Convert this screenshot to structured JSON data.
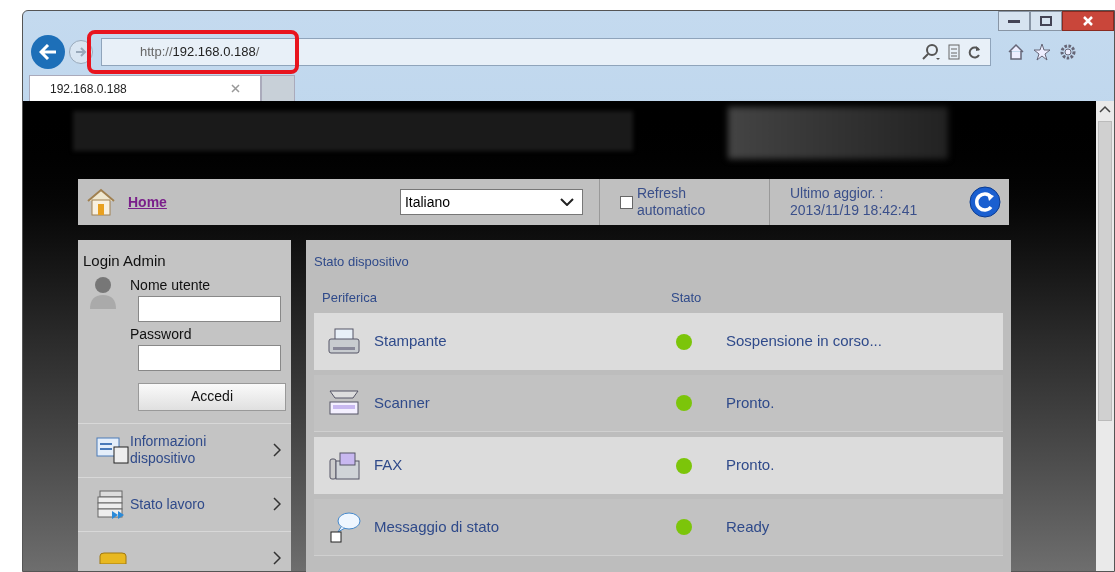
{
  "browser": {
    "address": {
      "prefix": "http://",
      "host": "192.168.0.188",
      "suffix": "/"
    },
    "tab": {
      "title": "192.168.0.188"
    }
  },
  "header": {
    "home_link": "Home",
    "language": "Italiano",
    "auto_refresh": {
      "label": "Refresh automatico",
      "checked": false
    },
    "last_update": {
      "label": "Ultimo aggior. :",
      "value": "2013/11/19 18:42:41"
    }
  },
  "login": {
    "title": "Login Admin",
    "username_label": "Nome utente",
    "password_label": "Password",
    "button": "Accedi"
  },
  "menu": [
    {
      "label": "Informazioni dispositivo",
      "kind": "info"
    },
    {
      "label": "Stato lavoro",
      "kind": "jobs"
    },
    {
      "kind": "folder"
    }
  ],
  "device_status": {
    "title": "Stato dispositivo",
    "columns": [
      "Periferica",
      "Stato"
    ],
    "rows": [
      {
        "kind": "printer",
        "name": "Stampante",
        "status": "Sospensione in corso...",
        "color": "#7cc50a"
      },
      {
        "kind": "scanner",
        "name": "Scanner",
        "status": "Pronto.",
        "color": "#7cc50a"
      },
      {
        "kind": "fax",
        "name": "FAX",
        "status": "Pronto.",
        "color": "#7cc50a"
      },
      {
        "kind": "message",
        "name": "Messaggio di stato",
        "status": "Ready",
        "color": "#7cc50a"
      }
    ]
  }
}
